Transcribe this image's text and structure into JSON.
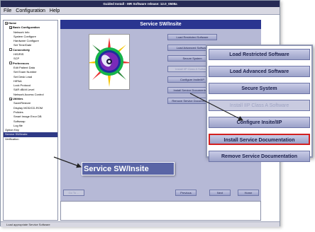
{
  "window": {
    "title": "Guided Install - MR Software release: 12.0_0508a"
  },
  "menu": {
    "items": [
      "File",
      "Configuration",
      "Help"
    ]
  },
  "tree": {
    "items": [
      {
        "label": "Home",
        "level": 0,
        "expander": true,
        "bold": true
      },
      {
        "label": "Basic Configuration",
        "level": 1,
        "expander": true,
        "bold": true
      },
      {
        "label": "Network Info",
        "level": 2
      },
      {
        "label": "System Configure",
        "level": 2
      },
      {
        "label": "Hardware Configure",
        "level": 2
      },
      {
        "label": "Set Time/Date",
        "level": 2
      },
      {
        "label": "Connectivity",
        "level": 1,
        "expander": true,
        "bold": true
      },
      {
        "label": "HIS/RIS",
        "level": 2
      },
      {
        "label": "SCP",
        "level": 2
      },
      {
        "label": "Preferences",
        "level": 1,
        "expander": true,
        "bold": true
      },
      {
        "label": "Edit Patient Data",
        "level": 2
      },
      {
        "label": "Set Exam Number",
        "level": 2
      },
      {
        "label": "Set Desk Lead",
        "level": 2
      },
      {
        "label": "HIPAA",
        "level": 2
      },
      {
        "label": "Lock Protocol",
        "level": 2
      },
      {
        "label": "SAR dB/dt Level",
        "level": 2
      },
      {
        "label": "Network Access Control",
        "level": 2
      },
      {
        "label": "Utilities",
        "level": 1,
        "expander": true,
        "bold": true
      },
      {
        "label": "Save/Restore",
        "level": 2
      },
      {
        "label": "Display MOD/CD-ROM",
        "level": 2
      },
      {
        "label": "Policies",
        "level": 2
      },
      {
        "label": "Smart Image Error DB",
        "level": 2
      },
      {
        "label": "Softswap",
        "level": 2
      },
      {
        "label": "Log file",
        "level": 2
      },
      {
        "label": "Option Key",
        "level": 0
      },
      {
        "label": "Service SW/Insite",
        "level": 0,
        "selected": true
      },
      {
        "label": "Verification",
        "level": 0
      }
    ]
  },
  "main": {
    "header": "Service SW/Insite",
    "buttons": [
      {
        "label": "Load Restricted Software",
        "disabled": false
      },
      {
        "label": "Load Advanced Software",
        "disabled": false
      },
      {
        "label": "Secure System",
        "disabled": false
      },
      {
        "label": "Install IIP Class A Software",
        "disabled": true
      },
      {
        "label": "Configure Insite/IIP",
        "disabled": false
      },
      {
        "label": "Install Service Documentation",
        "disabled": false
      },
      {
        "label": "Remove Service Documentation",
        "disabled": false
      }
    ],
    "nav": {
      "go_to": "Go To ...",
      "previous": "Previous",
      "next": "Next",
      "home": "Home"
    }
  },
  "status": {
    "text": "Load appropriate Service Software"
  },
  "zoom": {
    "buttons": [
      {
        "label": "Load Restricted Software",
        "disabled": false,
        "highlight": false
      },
      {
        "label": "Load Advanced Software",
        "disabled": false,
        "highlight": false
      },
      {
        "label": "Secure System",
        "disabled": false,
        "highlight": false
      },
      {
        "label": "Install IIP Class A Software",
        "disabled": true,
        "highlight": false
      },
      {
        "label": "Configure Insite/IIP",
        "disabled": false,
        "highlight": false
      },
      {
        "label": "Install Service Documentation",
        "disabled": false,
        "highlight": true
      },
      {
        "label": "Remove Service Documentation",
        "disabled": false,
        "highlight": false
      }
    ]
  },
  "callout": {
    "label": "Service SW/Insite"
  },
  "colors": {
    "titlebar": "#262a55",
    "header": "#2a3590",
    "panel": "#b6b9d6",
    "highlight_border": "#d32020"
  }
}
